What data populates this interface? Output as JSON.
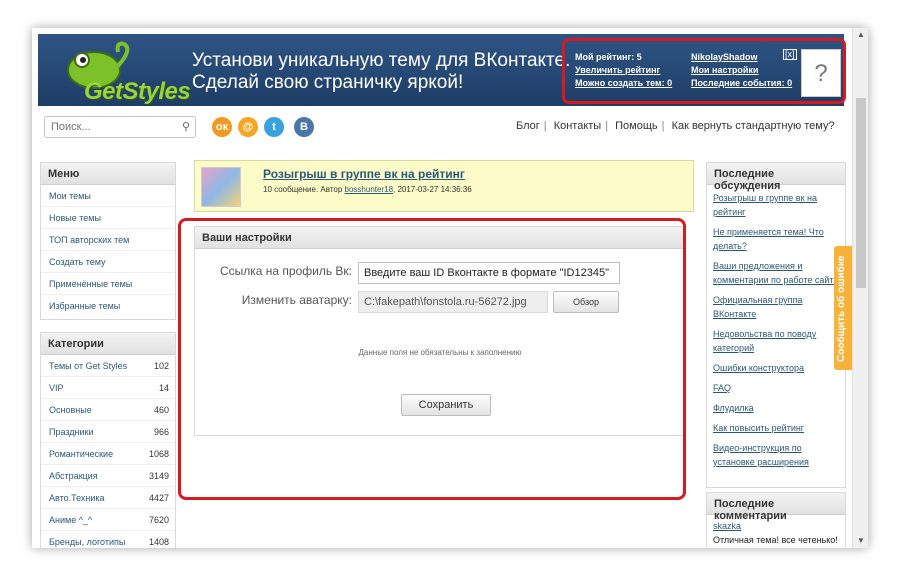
{
  "banner": {
    "logo_text": "GetStyles",
    "slogan_line1": "Установи уникальную тему для ВКонтакте.",
    "slogan_line2": "Сделай свою страничку яркой!"
  },
  "userbox": {
    "rating": "Мой рейтинг: 5",
    "increase_rating": "Увеличить рейтинг",
    "can_create": "Можно создать тем: 0",
    "username": "NikolayShadow",
    "my_settings": "Мои настройки",
    "last_events": "Последние события: 0",
    "close": "[x]",
    "avatar_placeholder": "?"
  },
  "search": {
    "placeholder": "Поиск..."
  },
  "social": [
    "ok",
    "mail",
    "twitter",
    "vk"
  ],
  "topnav": {
    "blog": "Блог",
    "contacts": "Контакты",
    "help": "Помощь",
    "revert": "Как вернуть стандартную тему?"
  },
  "menu": {
    "title": "Меню",
    "items": [
      "Мои темы",
      "Новые темы",
      "ТОП авторских тем",
      "Создать тему",
      "Применённые темы",
      "Избранные темы"
    ]
  },
  "categories": {
    "title": "Категории",
    "items": [
      {
        "name": "Темы от Get Styles",
        "count": "102"
      },
      {
        "name": "VIP",
        "count": "14"
      },
      {
        "name": "Основные",
        "count": "460"
      },
      {
        "name": "Праздники",
        "count": "966"
      },
      {
        "name": "Романтические",
        "count": "1068"
      },
      {
        "name": "Абстракция",
        "count": "3149"
      },
      {
        "name": "Авто.Техника",
        "count": "4427"
      },
      {
        "name": "Аниме ^_^",
        "count": "7620"
      },
      {
        "name": "Бренды, логотипы",
        "count": "1408"
      }
    ]
  },
  "giveaway": {
    "title": "Розыгрыш в группе вк на рейтинг",
    "meta_prefix": "10 сообщение. Автор",
    "author": "bosshunter18",
    "date": ", 2017-03-27 14:36:36"
  },
  "settings": {
    "title": "Ваши настройки",
    "vk_label": "Ссылка на профиль Вк:",
    "vk_value": "Введите ваш ID Вконтакте в формате \"ID12345\"",
    "avatar_label": "Изменить аватарку:",
    "file_value": "C:\\fakepath\\fonstola.ru-56272.jpg",
    "browse": "Обзор",
    "hint": "Данные поля не обязательны к заполнению",
    "save": "Сохранить"
  },
  "discussions": {
    "title": "Последние обсуждения",
    "items": [
      "Розыгрыш в группе вк на рейтинг",
      "Не применяется тема! Что делать?",
      "Ваши предложения и комментарии по работе сайта",
      "Официальная группа ВКонтакте",
      "Недовольства по поводу категорий",
      "Ошибки конструктора",
      "FAQ",
      "Флудилка",
      "Как повысить рейтинг",
      "Видео-инструкция по установке расширения"
    ]
  },
  "comments": {
    "title": "Последние комментарии",
    "author": "skazka",
    "text": "Отличная тема! все четенько!"
  },
  "bug_tab": "Сообщить об ошибке",
  "colors": {
    "banner": "#2f5585",
    "accent_red": "#d71920",
    "link": "#2b587a",
    "bug_tab": "#f7b23a"
  }
}
